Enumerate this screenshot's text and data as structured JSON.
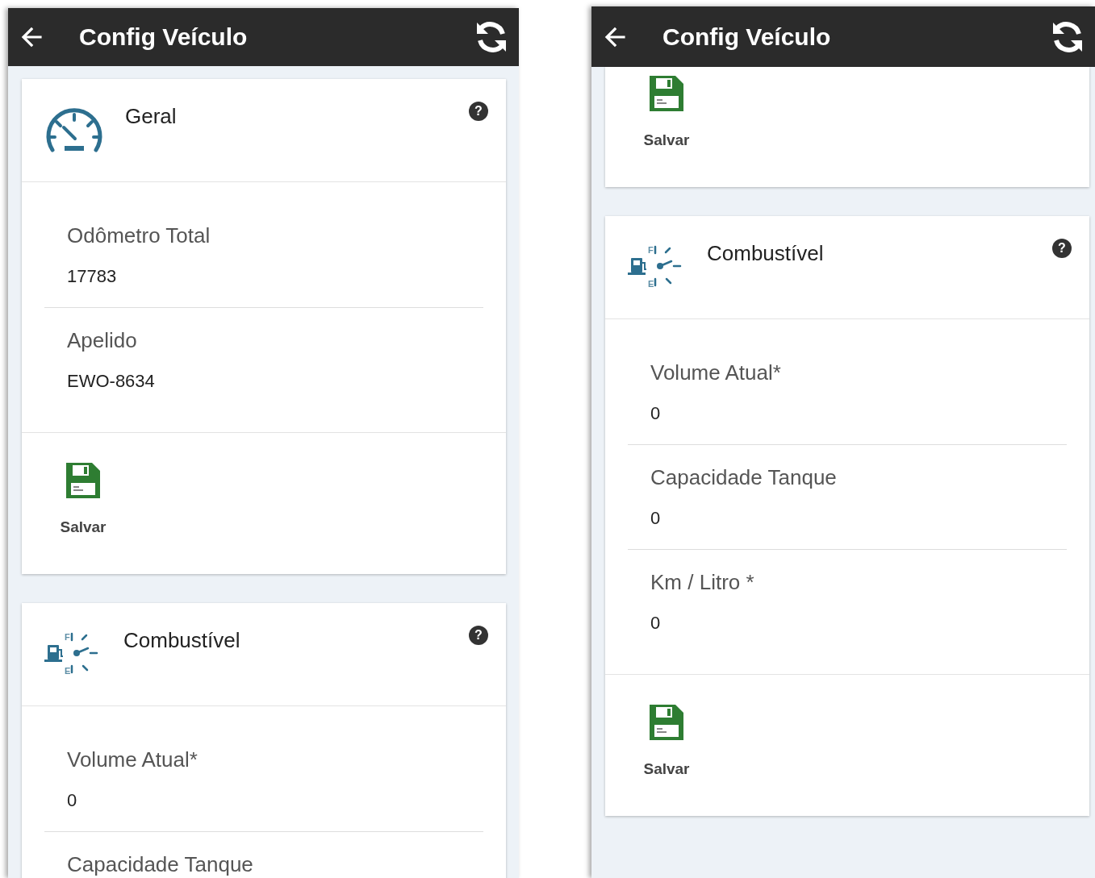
{
  "screens": [
    {
      "title": "Config Veículo",
      "cards": [
        {
          "header": {
            "kind": "speedometer",
            "title": "Geral",
            "help": "?"
          },
          "fields": [
            {
              "label": "Odômetro Total",
              "value": "17783"
            },
            {
              "label": "Apelido",
              "value": "EWO-8634"
            }
          ],
          "save": {
            "label": "Salvar"
          }
        },
        {
          "header": {
            "kind": "fuel",
            "gauge_labels": [
              "F",
              "E"
            ],
            "title": "Combustível",
            "help": "?"
          },
          "fields": [
            {
              "label": "Volume Atual*",
              "value": "0"
            },
            {
              "label": "Capacidade Tanque"
            }
          ]
        }
      ]
    },
    {
      "title": "Config Veículo",
      "cards": [
        {
          "save": {
            "label": "Salvar"
          }
        },
        {
          "header": {
            "kind": "fuel",
            "gauge_labels": [
              "F",
              "E"
            ],
            "title": "Combustível",
            "help": "?"
          },
          "fields": [
            {
              "label": "Volume Atual*",
              "value": "0"
            },
            {
              "label": "Capacidade Tanque",
              "value": "0"
            },
            {
              "label": "Km / Litro *",
              "value": "0"
            }
          ],
          "save": {
            "label": "Salvar"
          }
        }
      ]
    }
  ]
}
